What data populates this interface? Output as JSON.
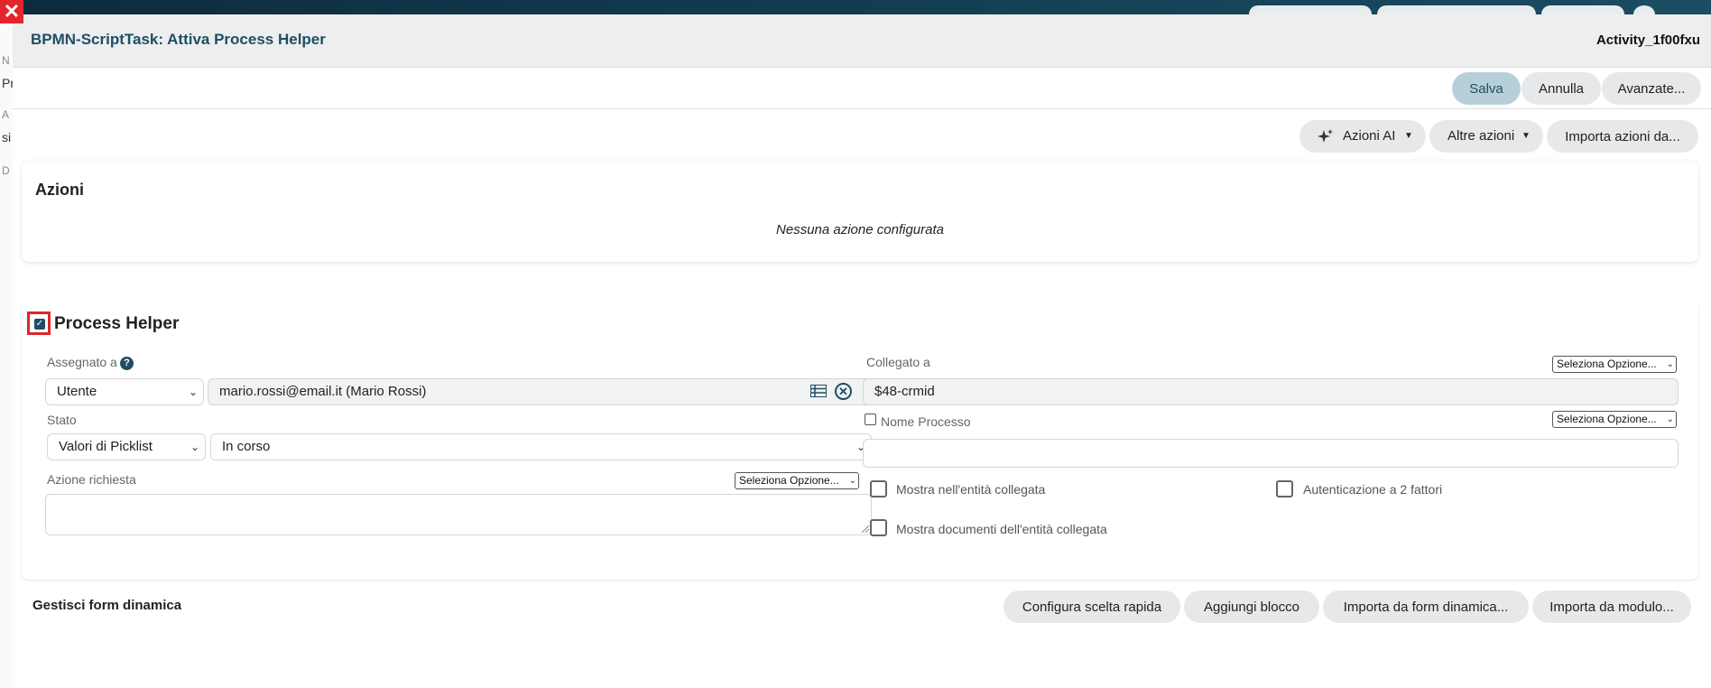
{
  "background": {
    "left_labels": [
      "N",
      "Pr",
      "A",
      "si",
      "D"
    ]
  },
  "close_icon": "close-icon",
  "modal": {
    "title": "BPMN-ScriptTask: Attiva Process Helper",
    "activity_id": "Activity_1f00fxu"
  },
  "toolbar": {
    "save_label": "Salva",
    "cancel_label": "Annulla",
    "advanced_label": "Avanzate..."
  },
  "actions_bar": {
    "ai_actions_label": "Azioni AI",
    "other_actions_label": "Altre azioni",
    "import_actions_label": "Importa azioni da..."
  },
  "actions_card": {
    "title": "Azioni",
    "empty_message": "Nessuna azione configurata"
  },
  "process_helper": {
    "title": "Process Helper",
    "enabled": true,
    "assigned_to": {
      "label": "Assegnato a",
      "type_value": "Utente",
      "user_value": "mario.rossi@email.it (Mario Rossi)"
    },
    "linked_to": {
      "label": "Collegato a",
      "option_select": "Seleziona Opzione...",
      "value": "$48-crmid"
    },
    "status": {
      "label": "Stato",
      "source_value": "Valori di Picklist",
      "value": "In corso"
    },
    "process_name": {
      "label": "Nome Processo",
      "checked": false,
      "option_select": "Seleziona Opzione...",
      "value": ""
    },
    "requested_action": {
      "label": "Azione richiesta",
      "option_select": "Seleziona Opzione...",
      "value": ""
    },
    "show_in_linked_entity": {
      "label": "Mostra nell'entità collegata",
      "checked": false
    },
    "two_factor_auth": {
      "label": "Autenticazione a 2 fattori",
      "checked": false
    },
    "show_linked_docs": {
      "label": "Mostra documenti dell'entità collegata",
      "checked": false
    }
  },
  "dynamic_form": {
    "title": "Gestisci form dinamica",
    "quick_choice_label": "Configura scelta rapida",
    "add_block_label": "Aggiungi blocco",
    "import_from_form_label": "Importa da form dinamica...",
    "import_from_module_label": "Importa da modulo..."
  },
  "colors": {
    "accent": "#1f4e63",
    "primary_button": "#b7cfd9",
    "highlight_border": "#e0252b"
  }
}
